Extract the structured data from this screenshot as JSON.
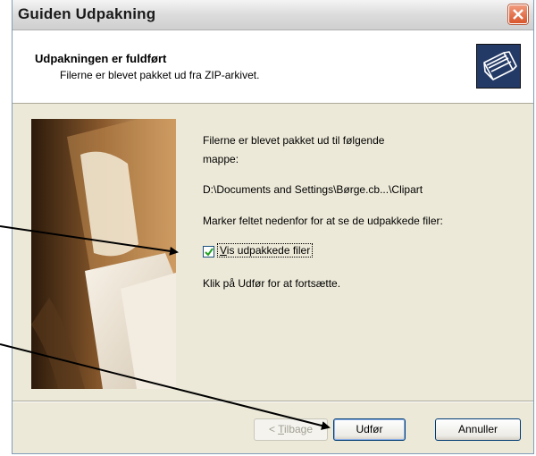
{
  "window": {
    "title": "Guiden Udpakning"
  },
  "header": {
    "title": "Udpakningen er fuldført",
    "subtitle": "Filerne er blevet pakket ud fra ZIP-arkivet.",
    "icon": "folder-cabinet-icon"
  },
  "content": {
    "line1": "Filerne er blevet pakket ud til følgende",
    "line2": "mappe:",
    "path": "D:\\Documents and Settings\\Børge.cb...\\Clipart",
    "instruction": "Marker feltet nedenfor for at se de udpakkede filer:",
    "checkbox": {
      "label_prefix": "V",
      "label_rest": "is udpakkede filer",
      "checked": true
    },
    "continue_text": "Klik på Udfør for at fortsætte."
  },
  "buttons": {
    "back": {
      "prefix": "< ",
      "accel": "T",
      "rest": "ilbage"
    },
    "finish": "Udfør",
    "cancel": "Annuller"
  }
}
